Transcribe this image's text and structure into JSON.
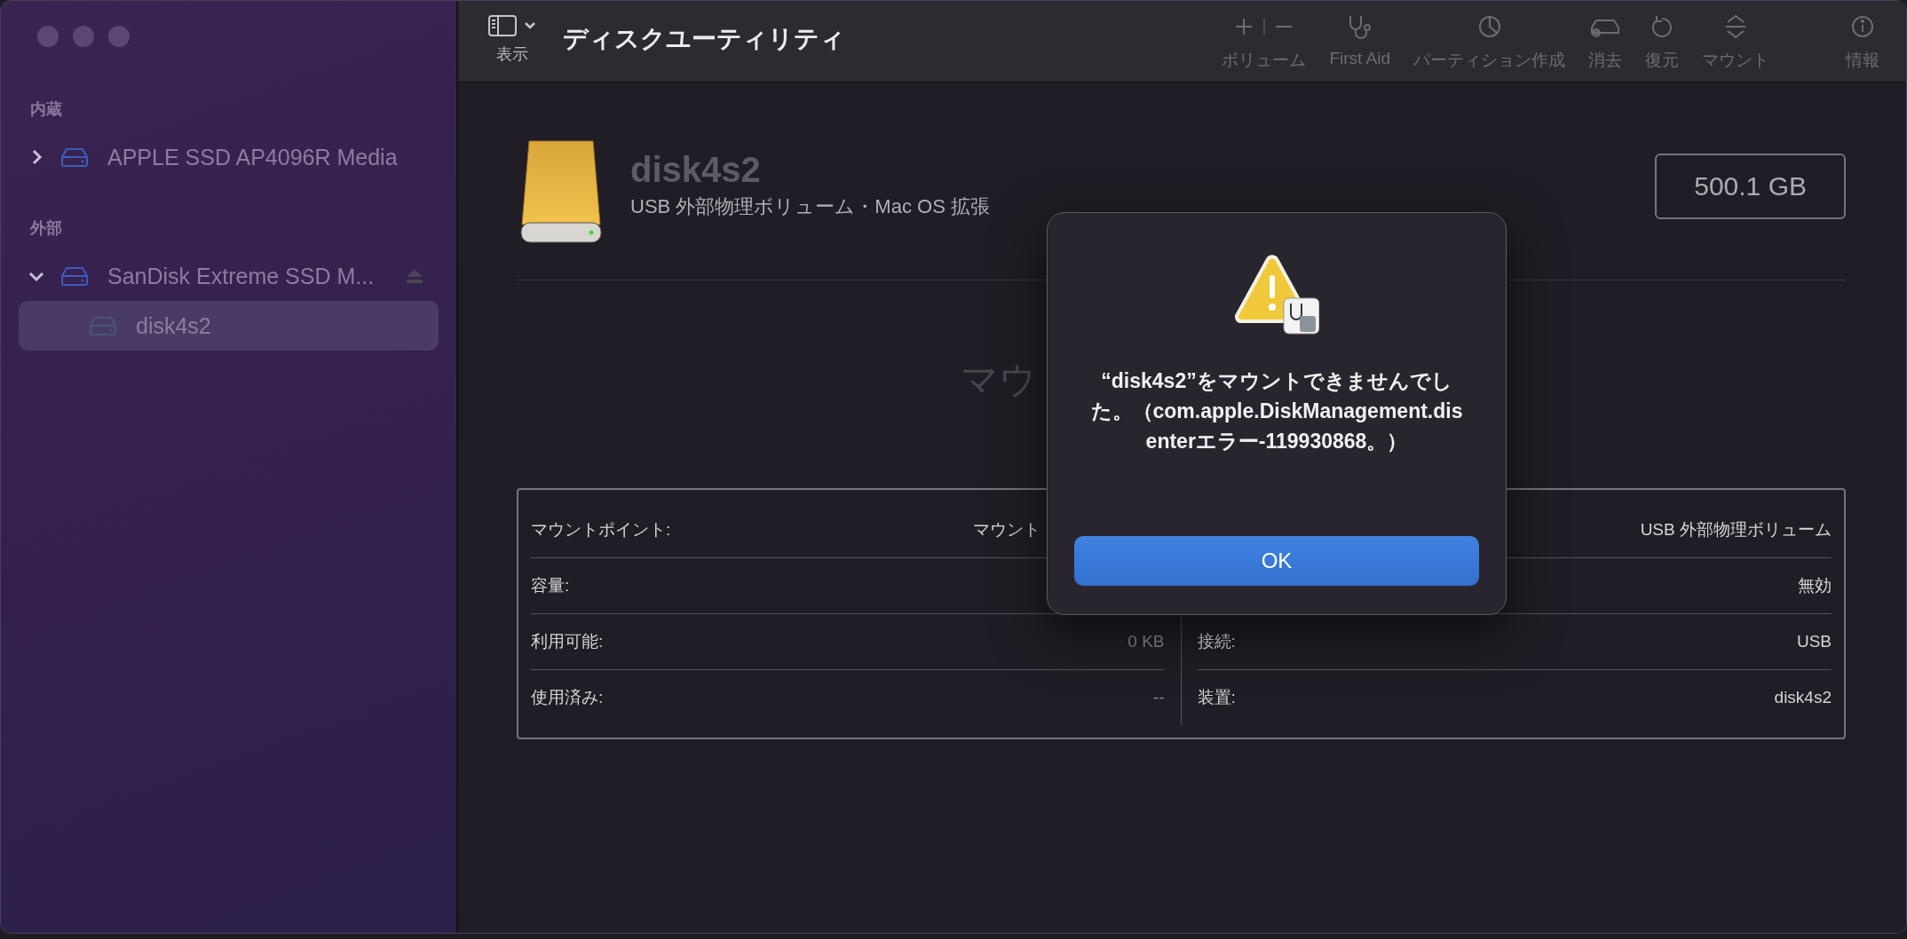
{
  "window": {
    "title": "ディスクユーティリティ"
  },
  "toolbar": {
    "view_label": "表示",
    "buttons": [
      {
        "kind": "volume",
        "label": "ボリューム",
        "disabled": true
      },
      {
        "kind": "first_aid",
        "label": "First Aid",
        "disabled": true
      },
      {
        "kind": "partition",
        "label": "パーティション作成",
        "disabled": true
      },
      {
        "kind": "erase",
        "label": "消去",
        "disabled": true
      },
      {
        "kind": "restore",
        "label": "復元",
        "disabled": true
      },
      {
        "kind": "mount",
        "label": "マウント",
        "disabled": true
      },
      {
        "kind": "info",
        "label": "情報",
        "disabled": true
      }
    ]
  },
  "sidebar": {
    "sections": [
      {
        "label": "内蔵",
        "items": [
          {
            "name": "APPLE SSD AP4096R Media",
            "expanded": false,
            "ejectable": false,
            "selected": false
          }
        ]
      },
      {
        "label": "外部",
        "items": [
          {
            "name": "SanDisk Extreme SSD M...",
            "expanded": true,
            "ejectable": true,
            "selected": false,
            "children": [
              {
                "name": "disk4s2",
                "selected": true
              }
            ]
          }
        ]
      }
    ]
  },
  "volume": {
    "name": "disk4s2",
    "description": "USB 外部物理ボリューム・Mac OS 拡張",
    "size": "500.1 GB",
    "status_text": "マウ"
  },
  "info": {
    "left": [
      {
        "label": "マウントポイント:",
        "value": "マウント"
      },
      {
        "label": "容量:"
      },
      {
        "label": "利用可能:",
        "value": "0 KB"
      },
      {
        "label": "使用済み:",
        "value": "--"
      }
    ],
    "right": [
      {
        "value": "USB 外部物理ボリューム"
      },
      {
        "value": "無効"
      },
      {
        "label": "接続:",
        "value": "USB"
      },
      {
        "label": "装置:",
        "value": "disk4s2"
      }
    ]
  },
  "dialog": {
    "message": "“disk4s2”をマウントできませんでした。（com.apple.DiskManagement.disenterエラー-119930868。）",
    "button": "OK"
  }
}
